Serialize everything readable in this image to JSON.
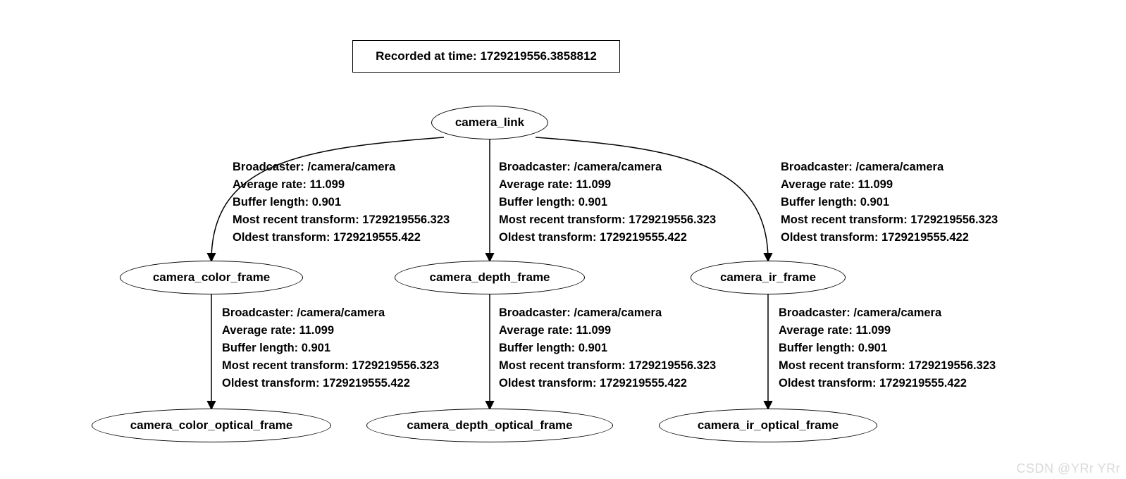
{
  "header": {
    "recorded_label": "Recorded at time:",
    "recorded_time": "1729219556.3858812"
  },
  "nodes": {
    "root": "camera_link",
    "color_frame": "camera_color_frame",
    "depth_frame": "camera_depth_frame",
    "ir_frame": "camera_ir_frame",
    "color_optical": "camera_color_optical_frame",
    "depth_optical": "camera_depth_optical_frame",
    "ir_optical": "camera_ir_optical_frame"
  },
  "edge_info": {
    "broadcaster_label": "Broadcaster:",
    "broadcaster_value": "/camera/camera",
    "avg_rate_label": "Average rate:",
    "avg_rate_value": "11.099",
    "buffer_label": "Buffer length:",
    "buffer_value": "0.901",
    "recent_label": "Most recent transform:",
    "recent_value": "1729219556.323",
    "oldest_label": "Oldest transform:",
    "oldest_value": "1729219555.422"
  },
  "watermark": "CSDN @YRr YRr"
}
